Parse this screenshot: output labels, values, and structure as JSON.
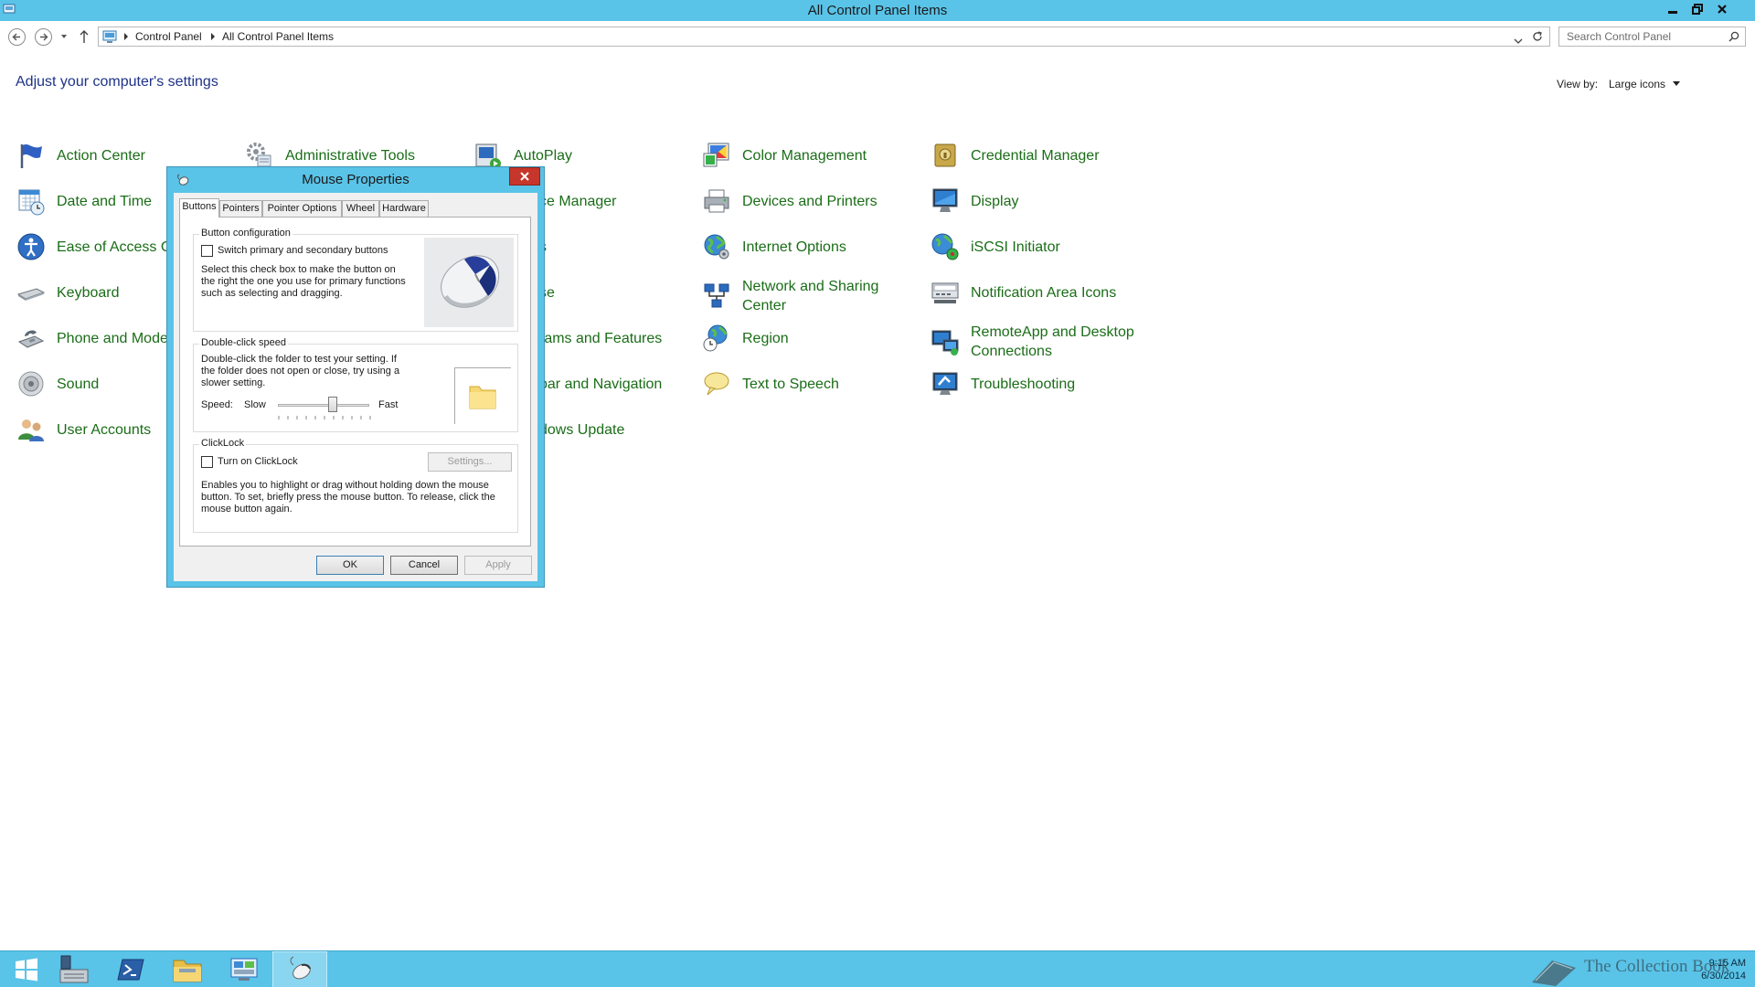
{
  "window": {
    "title": "All Control Panel Items"
  },
  "address": {
    "crumbs": [
      "Control Panel",
      "All Control Panel Items"
    ]
  },
  "search": {
    "placeholder": "Search Control Panel"
  },
  "page": {
    "heading": "Adjust your computer's settings"
  },
  "view_by": {
    "label": "View by:",
    "value": "Large icons"
  },
  "items": {
    "action_center": "Action Center",
    "administrative_tools": "Administrative Tools",
    "autoplay": "AutoPlay",
    "color_management": "Color Management",
    "credential_manager": "Credential Manager",
    "date_and_time": "Date and Time",
    "device_manager_partial": "ce Manager",
    "devices_and_printers": "Devices and Printers",
    "display": "Display",
    "ease_of_access_partial": "Ease of Access Ce",
    "fonts_partial": "s",
    "internet_options": "Internet Options",
    "iscsi_initiator": "iSCSI Initiator",
    "keyboard": "Keyboard",
    "mouse_partial": "se",
    "network_and_sharing": "Network and Sharing Center",
    "notification_area_icons": "Notification Area Icons",
    "phone_and_modem_partial": "Phone and Mode",
    "programs_and_features_partial": "rams and Features",
    "region": "Region",
    "remoteapp": "RemoteApp and Desktop Connections",
    "sound": "Sound",
    "taskbar_navigation_partial": "bar and Navigation",
    "text_to_speech": "Text to Speech",
    "troubleshooting": "Troubleshooting",
    "user_accounts": "User Accounts",
    "windows_update_partial": "dows Update"
  },
  "dialog": {
    "title": "Mouse Properties",
    "tabs": [
      "Buttons",
      "Pointers",
      "Pointer Options",
      "Wheel",
      "Hardware"
    ],
    "button_config": {
      "title": "Button configuration",
      "checkbox_label": "Switch primary and secondary buttons",
      "checked": false,
      "description": "Select this check box to make the button on the right the one you use for primary functions such as selecting and dragging."
    },
    "double_click": {
      "title": "Double-click speed",
      "description": "Double-click the folder to test your setting. If the folder does not open or close, try using a slower setting.",
      "speed_label": "Speed:",
      "slow_label": "Slow",
      "fast_label": "Fast",
      "slider_value": 0.6
    },
    "clicklock": {
      "title": "ClickLock",
      "checkbox_label": "Turn on ClickLock",
      "checked": false,
      "settings_button": "Settings...",
      "description": "Enables you to highlight or drag without holding down the mouse button. To set, briefly press the mouse button. To release, click the mouse button again."
    },
    "buttons": {
      "ok": "OK",
      "cancel": "Cancel",
      "apply": "Apply"
    }
  },
  "taskbar": {
    "time": "9:15 AM",
    "date": "6/30/2014",
    "watermark": "The Collection Book"
  }
}
